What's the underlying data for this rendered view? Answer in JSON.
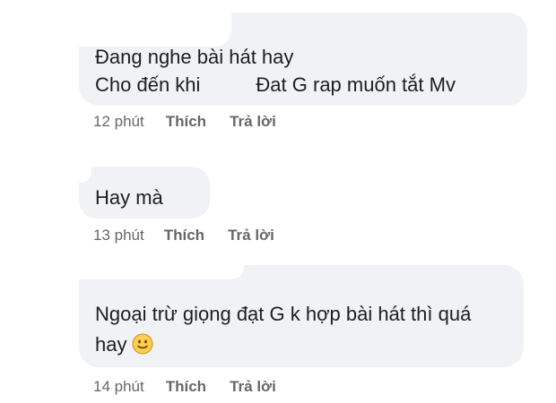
{
  "comments": [
    {
      "lines": [
        "Đang nghe bài hát hay",
        "Cho đến khi",
        "Đat G rap muốn tắt Mv"
      ],
      "time": "12 phút",
      "like_label": "Thích",
      "reply_label": "Trả lời"
    },
    {
      "lines": [
        "Hay mà"
      ],
      "time": "13 phút",
      "like_label": "Thích",
      "reply_label": "Trả lời"
    },
    {
      "lines": [
        "Ngoại trừ giọng đạt G k hợp bài hát thì quá",
        "hay"
      ],
      "emoji": "slightly-smiling-face-icon",
      "time": "14 phút",
      "like_label": "Thích",
      "reply_label": "Trả lời"
    }
  ],
  "colors": {
    "bubble_bg": "#f0f2f5",
    "text": "#1c1e21",
    "meta": "#65676b",
    "emoji_face": "#ffcc4d",
    "emoji_outline": "#c9961a"
  }
}
